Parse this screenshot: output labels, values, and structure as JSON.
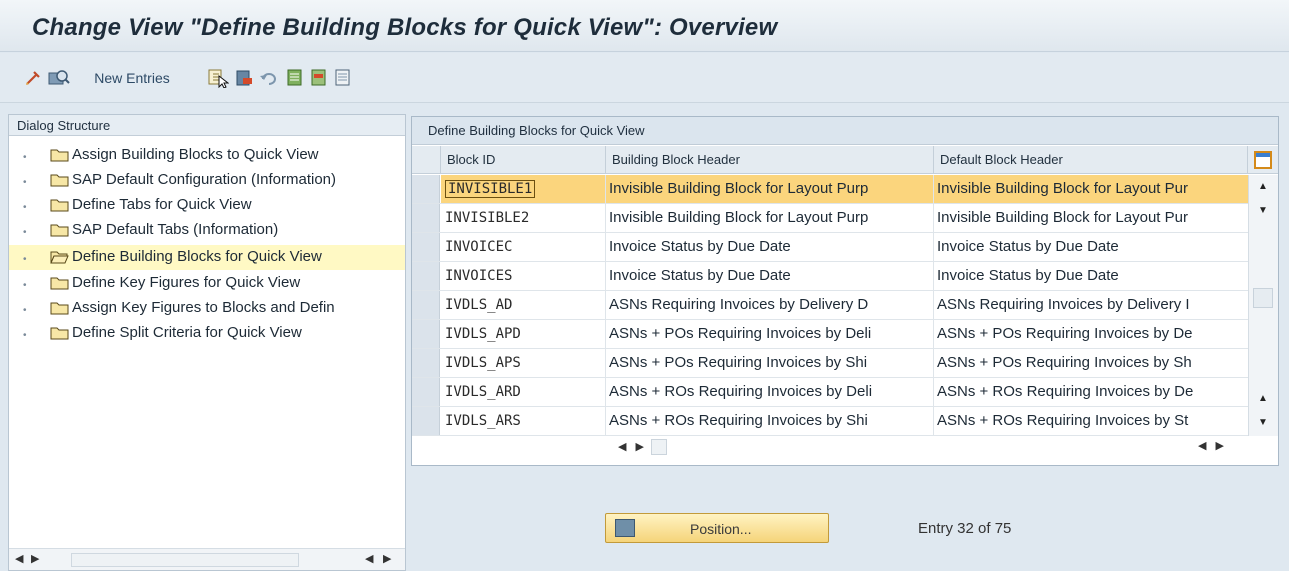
{
  "window": {
    "title": "Change View \"Define Building Blocks for Quick View\": Overview"
  },
  "toolbar": {
    "new_entries": "New Entries"
  },
  "dialog_structure": {
    "header": "Dialog Structure",
    "items": [
      {
        "label": "Assign Building Blocks to Quick View"
      },
      {
        "label": "SAP Default Configuration (Information)"
      },
      {
        "label": "Define Tabs for Quick View"
      },
      {
        "label": "SAP Default Tabs (Information)"
      },
      {
        "label": "Define Building Blocks for Quick View",
        "selected": true
      },
      {
        "label": "Define Key Figures for Quick View"
      },
      {
        "label": "Assign Key Figures to Blocks and Defin"
      },
      {
        "label": "Define Split Criteria for Quick View"
      }
    ]
  },
  "table": {
    "title": "Define Building Blocks for Quick View",
    "columns": [
      "Block ID",
      "Building Block Header",
      "Default Block Header"
    ],
    "rows": [
      [
        "INVISIBLE1",
        "Invisible Building Block for Layout Purp",
        "Invisible Building Block for Layout Pur"
      ],
      [
        "INVISIBLE2",
        "Invisible Building Block for Layout Purp",
        "Invisible Building Block for Layout Pur"
      ],
      [
        "INVOICEC",
        "Invoice Status by Due Date",
        "Invoice Status by Due Date"
      ],
      [
        "INVOICES",
        "Invoice Status by Due Date",
        "Invoice Status by Due Date"
      ],
      [
        "IVDLS_AD",
        "ASNs Requiring Invoices by Delivery D",
        "ASNs Requiring Invoices by Delivery I"
      ],
      [
        "IVDLS_APD",
        "ASNs + POs Requiring Invoices by Deli",
        "ASNs + POs Requiring Invoices by De"
      ],
      [
        "IVDLS_APS",
        "ASNs + POs Requiring Invoices by Shi",
        "ASNs + POs Requiring Invoices by Sh"
      ],
      [
        "IVDLS_ARD",
        "ASNs + ROs Requiring Invoices by Deli",
        "ASNs + ROs Requiring Invoices by De"
      ],
      [
        "IVDLS_ARS",
        "ASNs + ROs Requiring Invoices by Shi",
        "ASNs + ROs Requiring Invoices by St"
      ]
    ],
    "highlighted_row": 0
  },
  "footer": {
    "position_button": "Position...",
    "entry_text": "Entry 32 of 75"
  }
}
